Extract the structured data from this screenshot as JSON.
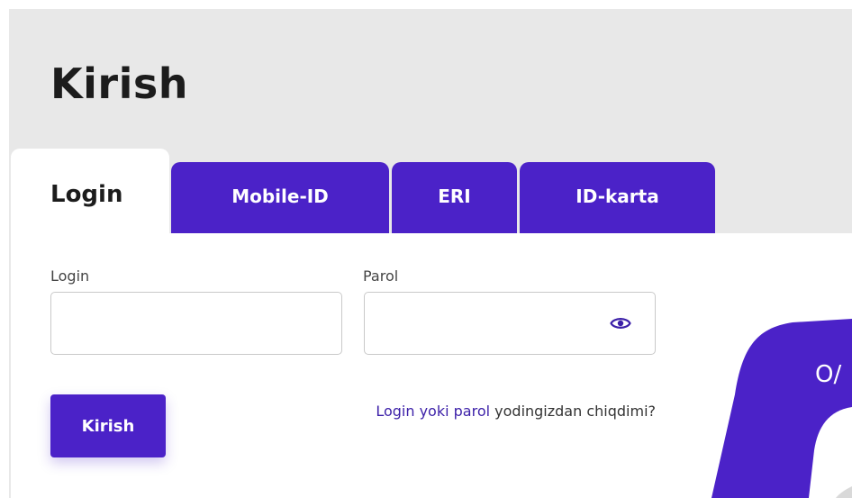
{
  "page": {
    "title": "Kirish"
  },
  "tabs": [
    {
      "label": "Login",
      "active": true
    },
    {
      "label": "Mobile-ID",
      "active": false
    },
    {
      "label": "ERI",
      "active": false
    },
    {
      "label": "ID-karta",
      "active": false
    }
  ],
  "form": {
    "login_label": "Login",
    "login_value": "",
    "parol_label": "Parol",
    "parol_value": "",
    "submit_label": "Kirish",
    "forgot_link": "Login yoki parol",
    "forgot_rest": " yodingizdan chiqdimi?",
    "password_toggle_icon": "eye-icon"
  },
  "decoration": {
    "partial_text": "O/"
  },
  "colors": {
    "accent": "#4b22c8",
    "link": "#3b1fa8",
    "background": "#e8e8e8",
    "panel": "#ffffff"
  }
}
